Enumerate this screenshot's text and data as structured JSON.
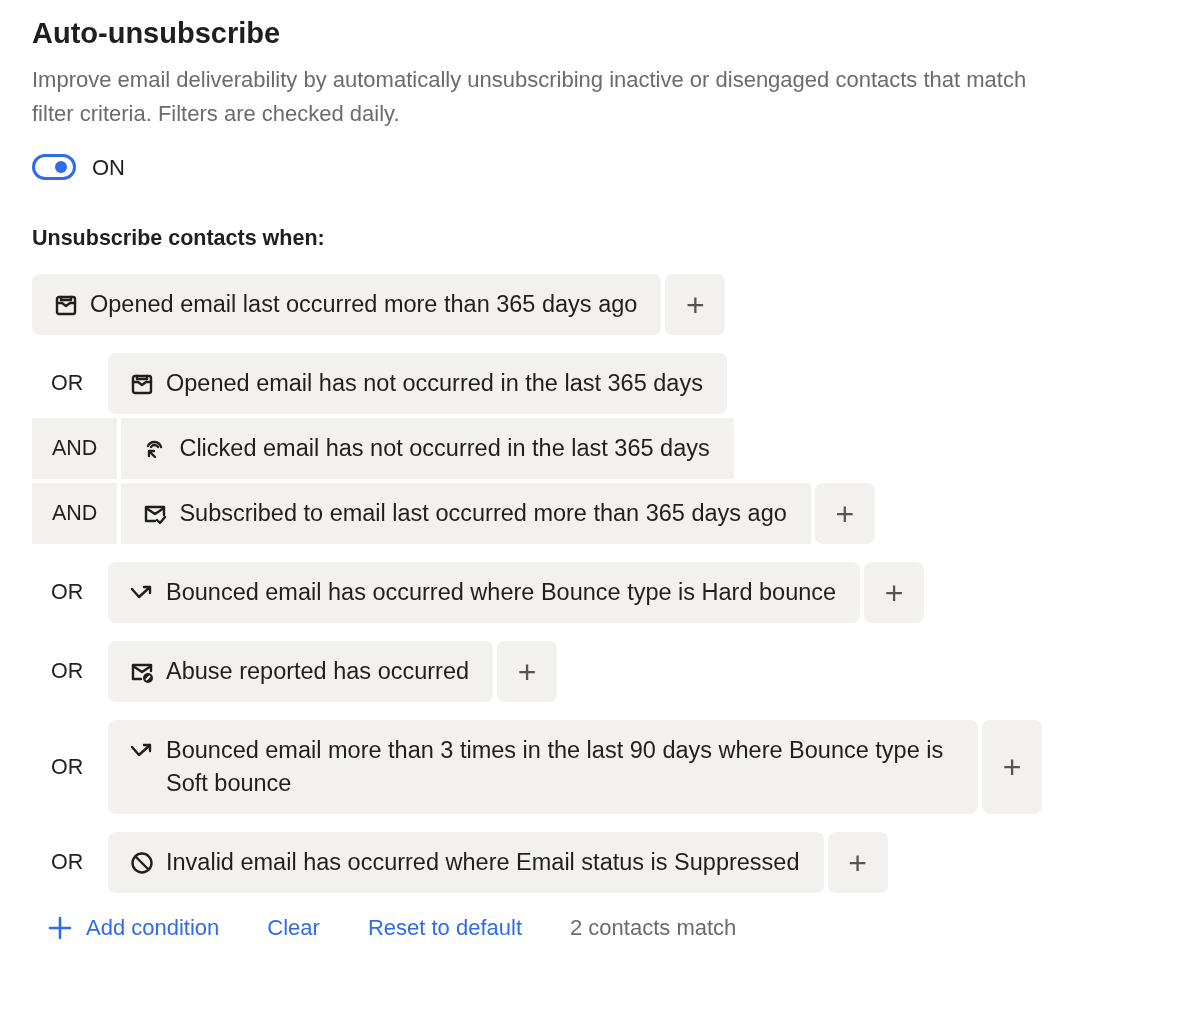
{
  "title": "Auto-unsubscribe",
  "description": "Improve email deliverability by automatically unsubscribing inactive or disengaged contacts that match filter criteria. Filters are checked daily.",
  "toggle": {
    "on": true,
    "label": "ON"
  },
  "section_label": "Unsubscribe contacts when:",
  "groups": [
    {
      "conditions": [
        {
          "kind": "opened",
          "text": "Opened email last occurred more than 365 days ago"
        }
      ],
      "add_label": "+"
    },
    {
      "operator": "OR",
      "conditions": [
        {
          "kind": "opened",
          "text": "Opened email has not occurred in the last 365 days"
        },
        {
          "operator": "AND",
          "kind": "clicked",
          "text": "Clicked email has not occurred in the last 365 days"
        },
        {
          "operator": "AND",
          "kind": "subscribed",
          "text": "Subscribed to email last occurred more than 365 days ago"
        }
      ],
      "add_label": "+"
    },
    {
      "operator": "OR",
      "conditions": [
        {
          "kind": "bounced",
          "text": "Bounced email has occurred where Bounce type is Hard bounce"
        }
      ],
      "add_label": "+"
    },
    {
      "operator": "OR",
      "conditions": [
        {
          "kind": "abuse",
          "text": "Abuse reported has occurred"
        }
      ],
      "add_label": "+"
    },
    {
      "operator": "OR",
      "conditions": [
        {
          "kind": "bounced",
          "text": "Bounced email more than 3 times in the last 90 days where Bounce type is Soft bounce"
        }
      ],
      "add_label": "+"
    },
    {
      "operator": "OR",
      "conditions": [
        {
          "kind": "invalid",
          "text": "Invalid email has occurred where Email status is Suppressed"
        }
      ],
      "add_label": "+"
    }
  ],
  "footer": {
    "add_condition": "Add condition",
    "clear": "Clear",
    "reset": "Reset to default",
    "match_count": "2 contacts match"
  }
}
